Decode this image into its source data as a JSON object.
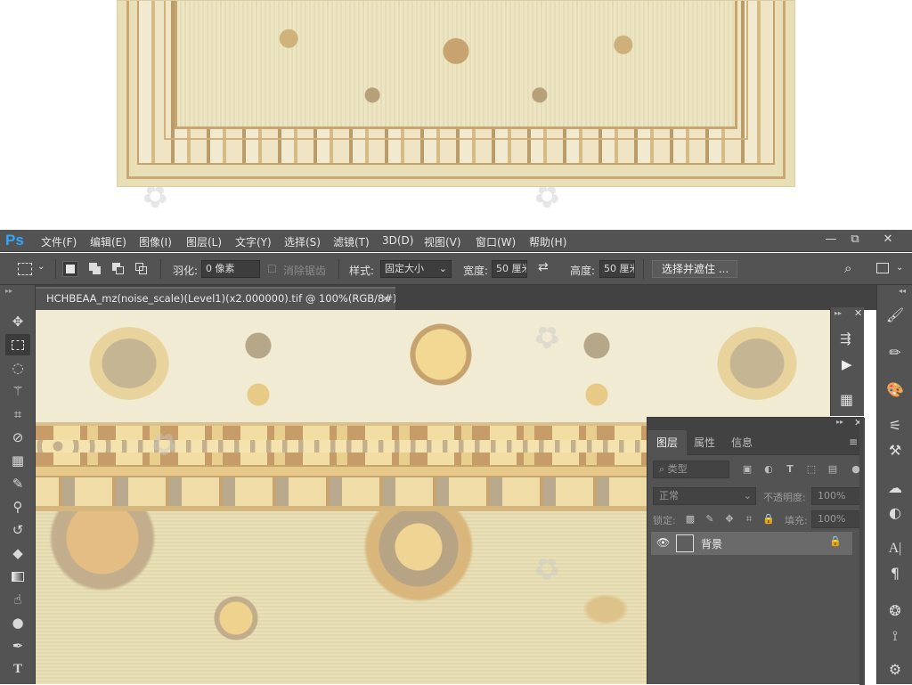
{
  "app": {
    "logo": "Ps"
  },
  "menu": [
    "文件(F)",
    "编辑(E)",
    "图像(I)",
    "图层(L)",
    "文字(Y)",
    "选择(S)",
    "滤镜(T)",
    "3D(D)",
    "视图(V)",
    "窗口(W)",
    "帮助(H)"
  ],
  "window_controls": {
    "minimize": "—",
    "restore": "⧉",
    "close": "✕"
  },
  "options": {
    "feather_label": "羽化:",
    "feather_value": "0 像素",
    "antialias_label": "消除锯齿",
    "style_label": "样式:",
    "style_value": "固定大小",
    "width_label": "宽度:",
    "width_value": "50 厘米",
    "height_label": "高度:",
    "height_value": "50 厘米",
    "select_mask_button": "选择并遮住 ..."
  },
  "document_tab": {
    "title": "HCHBEAA_mz(noise_scale)(Level1)(x2.000000).tif @ 100%(RGB/8#) *",
    "close": "×"
  },
  "layers_panel": {
    "tabs": [
      "图层",
      "属性",
      "信息"
    ],
    "filter_label": "类型",
    "blend_mode": "正常",
    "opacity_label": "不透明度:",
    "opacity_value": "100%",
    "lock_label": "锁定:",
    "fill_label": "填充:",
    "fill_value": "100%",
    "layers": [
      {
        "name": "背景",
        "visible": true,
        "locked": true
      }
    ]
  },
  "icons": {
    "tools": [
      "move-icon",
      "rect-marquee-icon",
      "lasso-icon",
      "magic-wand-icon",
      "crop-icon",
      "eyedropper-icon",
      "healing-brush-icon",
      "brush-icon",
      "clone-stamp-icon",
      "history-brush-icon",
      "eraser-icon",
      "gradient-icon",
      "smudge-icon",
      "dodge-icon",
      "pen-icon",
      "type-icon"
    ],
    "accent": "#31a8ff"
  }
}
